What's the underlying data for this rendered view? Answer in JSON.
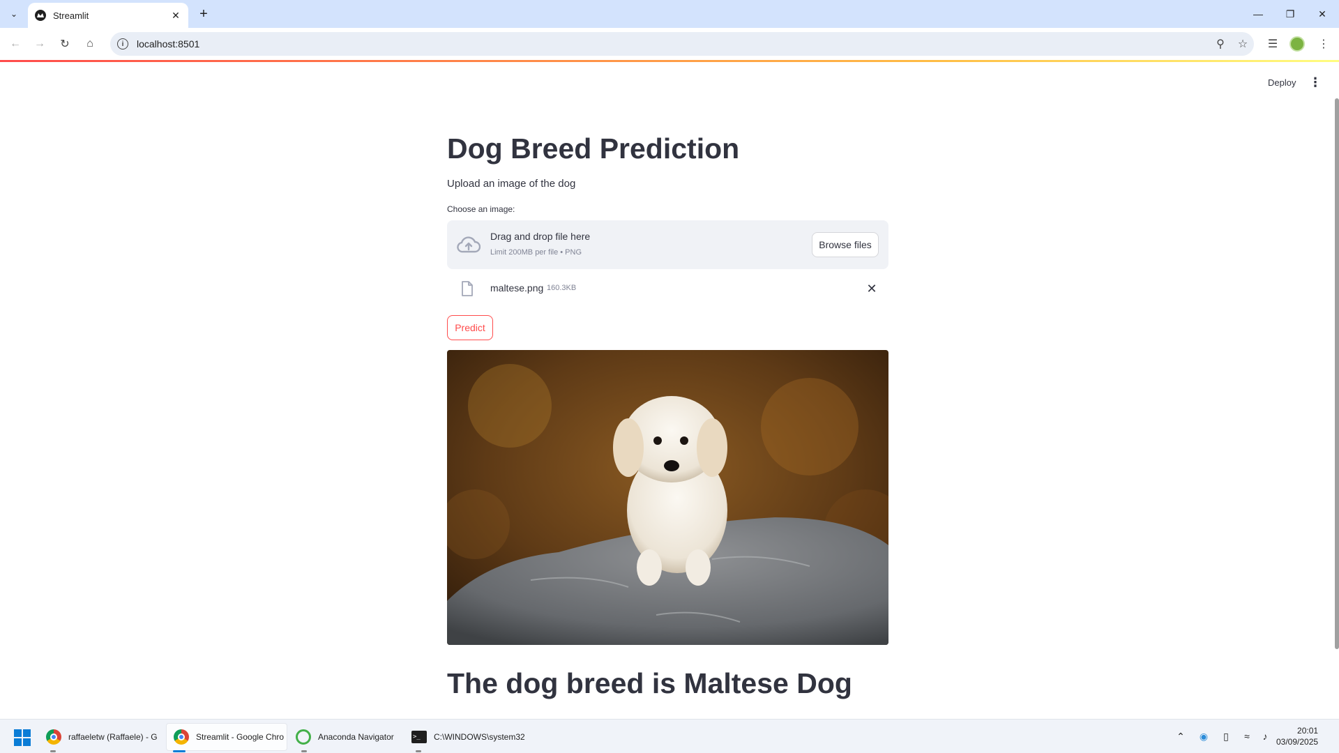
{
  "browser": {
    "tab_title": "Streamlit",
    "url": "localhost:8501"
  },
  "app": {
    "deploy_label": "Deploy",
    "title": "Dog Breed Prediction",
    "subtitle": "Upload an image of the dog",
    "uploader_label": "Choose an image:",
    "dropzone_title": "Drag and drop file here",
    "dropzone_limit": "Limit 200MB per file • PNG",
    "browse_label": "Browse files",
    "file_name": "maltese.png",
    "file_size": "160.3KB",
    "predict_label": "Predict",
    "result": "The dog breed is Maltese Dog",
    "accent_color": "#ff4b4b"
  },
  "taskbar": {
    "apps": [
      {
        "label": "raffaeletw (Raffaele) - G",
        "icon": "chrome-icon"
      },
      {
        "label": "Streamlit - Google Chro",
        "icon": "chrome-icon"
      },
      {
        "label": "Anaconda Navigator",
        "icon": "anaconda-icon"
      },
      {
        "label": "C:\\WINDOWS\\system32",
        "icon": "terminal-icon"
      }
    ],
    "time": "20:01",
    "date": "03/09/2025"
  }
}
